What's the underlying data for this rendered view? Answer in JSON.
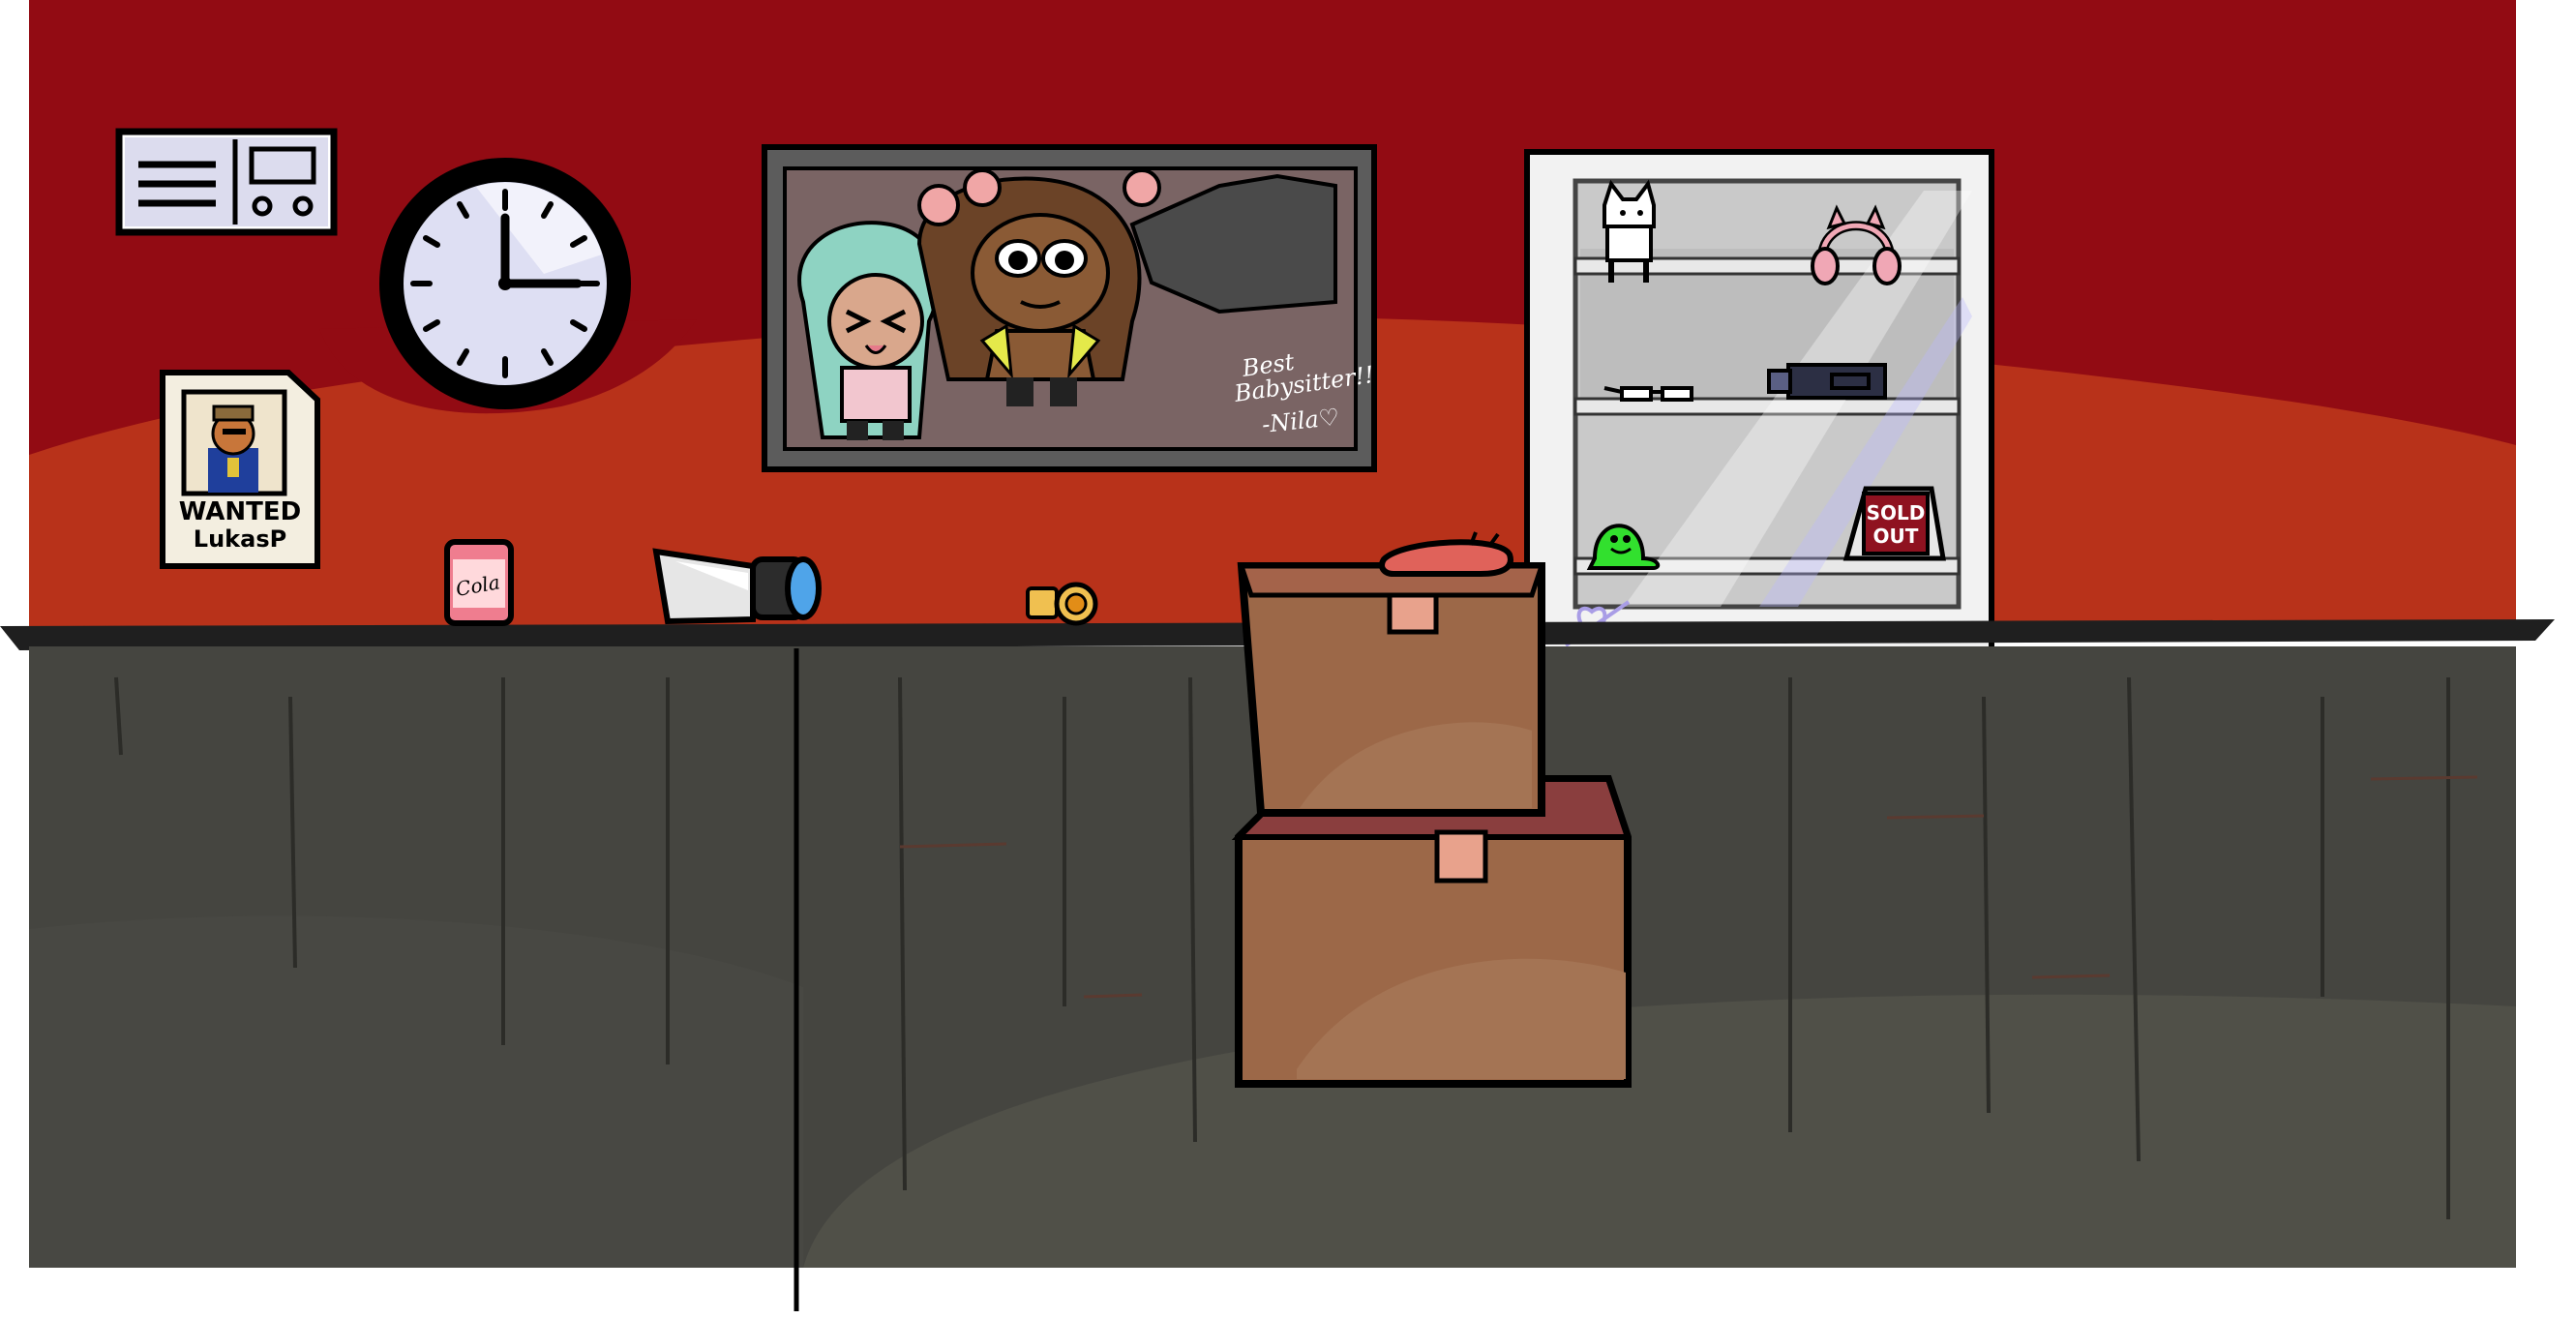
{
  "scene": {
    "colors": {
      "wall_dark": "#920b13",
      "wall_band": "#b8321a",
      "counter_top": "#1f1f1f",
      "counter_front": "#454540",
      "box_brown": "#9c6848",
      "box_tape": "#e8a28c",
      "case_white": "#f2f2f2",
      "shelf_grey": "#d9d9d9"
    }
  },
  "wall_panel": {
    "icon": "control-panel-icon"
  },
  "clock": {
    "icon": "wall-clock-icon",
    "time_shown": "3:00"
  },
  "wanted_poster": {
    "line1": "WANTED",
    "line2": "LukasP",
    "icon": "wanted-poster-icon"
  },
  "photo_frame": {
    "caption_line1": "Best",
    "caption_line2": "Babysitter!!",
    "caption_line3": "-Nila♡",
    "icon": "framed-photo-icon"
  },
  "counter_items": {
    "cola": {
      "label": "Cola",
      "icon": "cola-can-icon"
    },
    "flashlight": {
      "icon": "flashlight-icon"
    },
    "coin": {
      "icon": "coin-icon"
    },
    "sausage": {
      "icon": "sausage-icon"
    }
  },
  "display_case": {
    "icon": "display-case-icon",
    "items": [
      {
        "name": "cat-figurine",
        "icon": "cat-figurine-icon"
      },
      {
        "name": "cat-ear-headphones",
        "icon": "headphones-icon"
      },
      {
        "name": "glasses",
        "icon": "glasses-icon"
      },
      {
        "name": "camera",
        "icon": "camera-icon"
      },
      {
        "name": "green-slime",
        "icon": "slime-icon"
      }
    ],
    "sold_out_sign": {
      "line1": "SOLD",
      "line2": "OUT"
    }
  },
  "boxes": {
    "icon": "cardboard-box-icon",
    "count": 2
  }
}
